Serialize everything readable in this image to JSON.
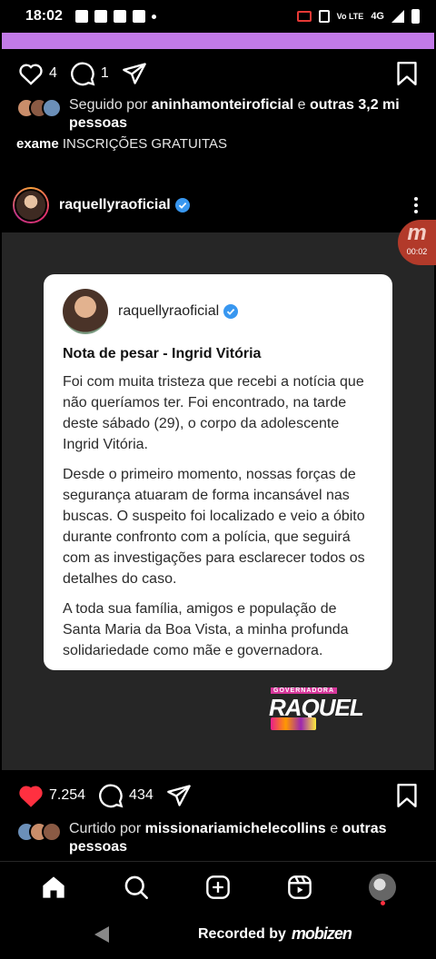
{
  "status_bar": {
    "time": "18:02",
    "network": "4G",
    "volte": "Vo LTE"
  },
  "top_actions": {
    "like_count": "4",
    "comment_count": "1"
  },
  "followed": {
    "prefix": "Seguido por ",
    "user": "aninhamonteiroficial",
    "middle": " e ",
    "rest": "outras 3,2 mi pessoas"
  },
  "caption": {
    "user": "exame",
    "text": "INSCRIÇÕES GRATUITAS"
  },
  "post": {
    "username": "raquellyraoficial",
    "card": {
      "username": "raquellyraoficial",
      "title": "Nota de pesar - Ingrid Vitória",
      "paragraphs": [
        "Foi com muita tristeza que recebi a notícia que não queríamos ter. Foi encontrado, na tarde deste sábado (29), o corpo da adolescente Ingrid Vitória.",
        "Desde o primeiro momento, nossas forças de segurança atuaram de forma incansável nas buscas. O suspeito foi localizado e veio a óbito durante confronto com a polícia, que seguirá com as investigações para esclarecer todos os detalhes do caso.",
        "A toda sua família, amigos e população de Santa Maria da Boa Vista, a minha profunda solidariedade como mãe e governadora."
      ]
    },
    "logo": {
      "small": "GOVERNADORA",
      "big": "RAQUEL"
    },
    "likes": "7.254",
    "comments": "434",
    "liked_by": {
      "prefix": "Curtido por ",
      "user": "missionariamichelecollins",
      "middle": " e ",
      "rest": "outras pessoas"
    }
  },
  "recorder": {
    "bubble_letter": "m",
    "bubble_time": "00:02",
    "label": "Recorded by",
    "brand": "mobizen"
  },
  "colors": {
    "accent_purple": "#c27ae8",
    "like_red": "#ff3040",
    "verified_blue": "#3897f0"
  }
}
